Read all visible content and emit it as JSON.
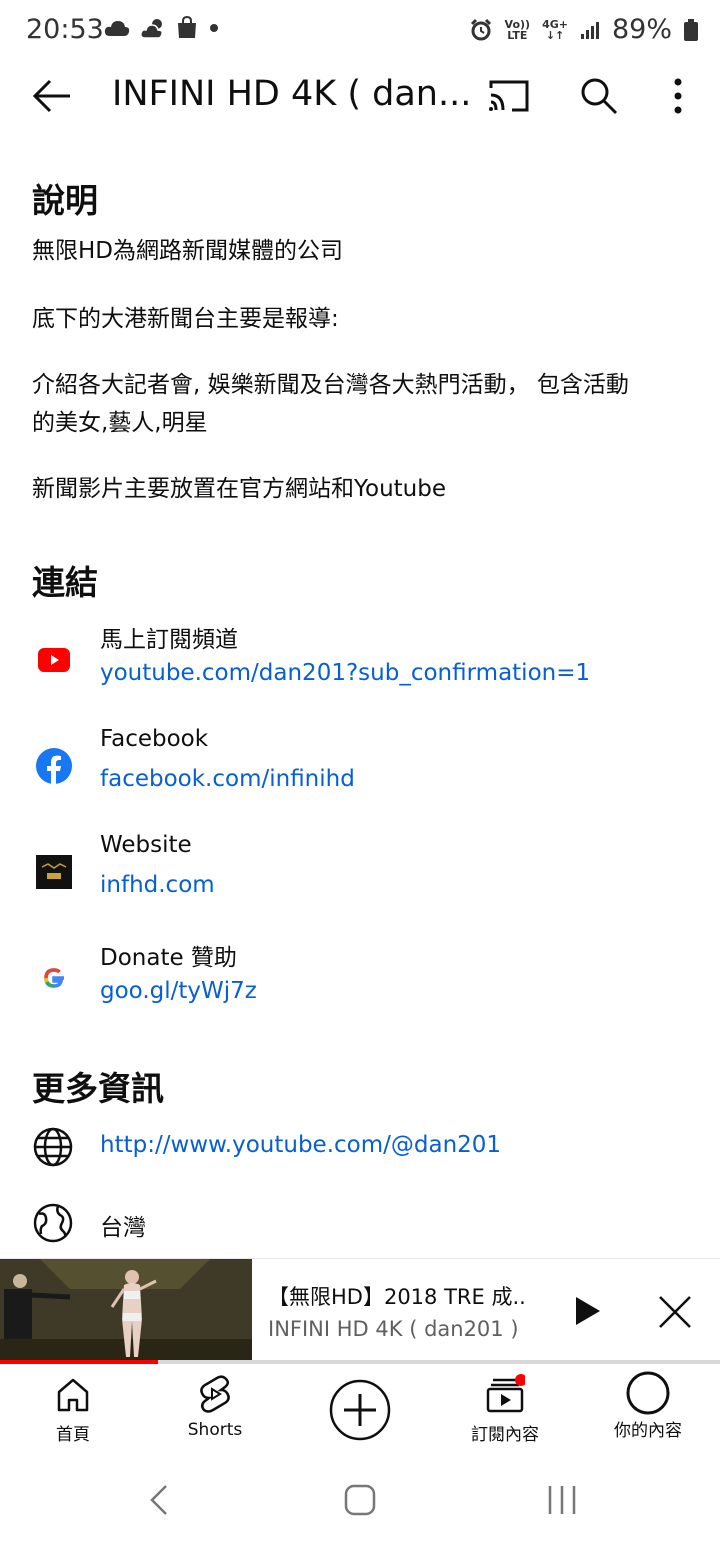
{
  "status_bar": {
    "time": "20:53",
    "network_label_1": "Vo))",
    "network_label_2": "LTE",
    "network_type": "4G+",
    "battery": "89%"
  },
  "app_bar": {
    "title": "INFINI HD 4K ( dan..."
  },
  "description": {
    "heading": "說明",
    "lines": [
      "無限HD為網路新聞媒體的公司",
      "底下的大港新聞台主要是報導:",
      "介紹各大記者會, 娛樂新聞及台灣各大熱門活動， 包含活動",
      "的美女,藝人,明星",
      "新聞影片主要放置在官方網站和Youtube"
    ]
  },
  "links": {
    "heading": "連結",
    "items": [
      {
        "name": "馬上訂閱頻道",
        "url": "youtube.com/dan201?sub_confirmation=1",
        "icon": "youtube-icon"
      },
      {
        "name": "Facebook",
        "url": "facebook.com/infinihd",
        "icon": "facebook-icon"
      },
      {
        "name": "Website",
        "url": "infhd.com",
        "icon": "website-logo-icon"
      },
      {
        "name": "Donate 贊助",
        "url": "goo.gl/tyWj7z",
        "icon": "google-icon"
      }
    ]
  },
  "more_info": {
    "heading": "更多資訊",
    "channel_url": "http://www.youtube.com/@dan201",
    "country": "台灣"
  },
  "mini_player": {
    "title": "【無限HD】2018 TRE 成..",
    "channel": "INFINI HD 4K ( dan201 )",
    "progress_fraction": 0.22
  },
  "bottom_nav": {
    "home": "首頁",
    "shorts": "Shorts",
    "subscriptions": "訂閱內容",
    "you": "你的內容"
  },
  "colors": {
    "link": "#065fd4",
    "youtube_red": "#ff0000",
    "facebook_blue": "#1877f2"
  }
}
